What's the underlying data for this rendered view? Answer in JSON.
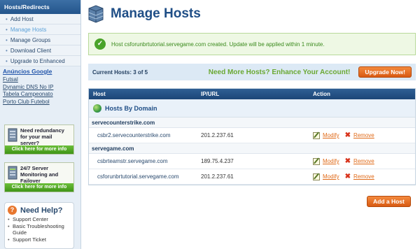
{
  "sidebar": {
    "header": "Hosts/Redirects",
    "menu": [
      {
        "label": "Add Host"
      },
      {
        "label": "Manage Hosts"
      },
      {
        "label": "Manage Groups"
      },
      {
        "label": "Download Client"
      },
      {
        "label": "Upgrade to Enhanced"
      }
    ],
    "ads_title": "Anúncios Google",
    "ad_links": [
      "Futsal",
      "Dynamic DNS No IP",
      "Tabela Campeonato",
      "Porto Club Futebol"
    ],
    "promo1": {
      "text": "Need redundancy for your mail server?",
      "button": "Click here for more info"
    },
    "promo2": {
      "text": "24/7 Server Monitoring and Failover",
      "button": "Click here for more info"
    },
    "help": {
      "title": "Need Help?",
      "items": [
        "Support Center",
        "Basic Troubleshooting Guide",
        "Support Ticket"
      ]
    }
  },
  "main": {
    "title": "Manage Hosts",
    "success_message": "Host csforunbrtutorial.servegame.com created. Update will be applied within 1 minute.",
    "current_hosts": "Current Hosts: 3 of 5",
    "enhance_text": "Need More Hosts? Enhance Your Account!",
    "upgrade_button": "Upgrade Now!",
    "table": {
      "headers": {
        "host": "Host",
        "ip": "IP/URL",
        "action": "Action"
      },
      "section_title": "Hosts By Domain",
      "modify_label": "Modify",
      "remove_label": "Remove",
      "groups": [
        {
          "domain": "servecounterstrike.com",
          "hosts": [
            {
              "host": "csbr2.servecounterstrike.com",
              "ip": "201.2.237.61"
            }
          ]
        },
        {
          "domain": "servegame.com",
          "hosts": [
            {
              "host": "csbrteamstr.servegame.com",
              "ip": "189.75.4.237"
            },
            {
              "host": "csforunbrtutorial.servegame.com",
              "ip": "201.2.237.61"
            }
          ]
        }
      ]
    },
    "add_host_button": "Add a Host"
  }
}
